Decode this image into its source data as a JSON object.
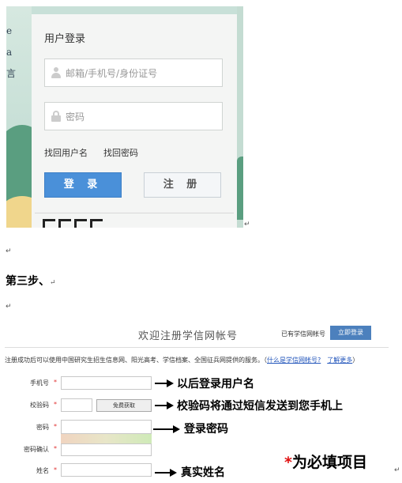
{
  "login": {
    "side_chars": [
      "e",
      "a",
      "言"
    ],
    "title": "用户登录",
    "username_placeholder": "邮箱/手机号/身份证号",
    "password_placeholder": "密码",
    "find_username": "找回用户名",
    "find_password": "找回密码",
    "login_button": "登 录",
    "register_button": "注 册"
  },
  "doc": {
    "para_mark": "↵",
    "step_heading": "第三步、"
  },
  "register": {
    "title": "欢迎注册学信网帐号",
    "has_account": "已有学信网帐号",
    "login_now": "立即登录",
    "info_text": "注册成功后可以使用中国研究生招生信息网、阳光高考、学信档案、全国征兵网提供的服务。（",
    "what_is_link": "什么是学信网帐号?",
    "learn_more": "了解更多",
    "info_close": "）",
    "fields": {
      "phone": "手机号",
      "code": "校验码",
      "password": "密码",
      "confirm": "密码确认",
      "name": "姓名"
    },
    "required_mark": "*",
    "get_code_button": "免费获取"
  },
  "annotations": {
    "phone": "以后登录用户名",
    "code": "校验码将通过短信发送到您手机上",
    "password": "登录密码",
    "name": "真实姓名",
    "required_star": "*",
    "required_text": "为必填项目"
  }
}
